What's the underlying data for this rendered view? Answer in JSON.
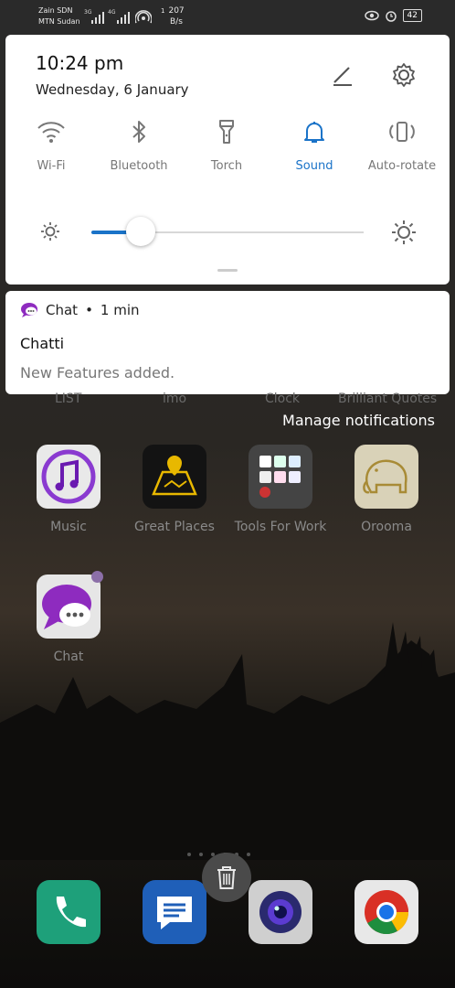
{
  "status_bar": {
    "operator_1": "Zain SDN",
    "operator_2": "MTN Sudan",
    "net_1": "3G",
    "net_2": "4G",
    "speed_value": "207",
    "speed_unit": "B/s",
    "speed_prefix": "1",
    "battery": "42"
  },
  "quick_settings": {
    "time": "10:24 pm",
    "date": "Wednesday, 6 January",
    "tiles": [
      {
        "label": "Wi-Fi",
        "icon": "wifi-icon",
        "active": false
      },
      {
        "label": "Bluetooth",
        "icon": "bluetooth-icon",
        "active": false
      },
      {
        "label": "Torch",
        "icon": "torch-icon",
        "active": false
      },
      {
        "label": "Sound",
        "icon": "bell-icon",
        "active": true
      },
      {
        "label": "Auto-rotate",
        "icon": "auto-rotate-icon",
        "active": false
      }
    ],
    "brightness_level": 0.18,
    "accent_color": "#1a73c8"
  },
  "notification": {
    "app_name": "Chat",
    "separator": "•",
    "age": "1 min",
    "title": "Chatti",
    "body": "New Features added."
  },
  "manage_notifications": "Manage notifications",
  "home": {
    "hidden_labels": [
      "LIST",
      "imo",
      "Clock",
      "Brilliant Quotes"
    ],
    "apps_row1": [
      {
        "label": "Music",
        "icon": "music-icon"
      },
      {
        "label": "Great Places",
        "icon": "map-icon"
      },
      {
        "label": "Tools For Work",
        "icon": "folder-icon"
      },
      {
        "label": "Orooma",
        "icon": "elephant-icon"
      }
    ],
    "apps_row2": [
      {
        "label": "Chat",
        "icon": "chat-bubble-icon"
      }
    ],
    "dock": [
      "phone-icon",
      "messages-icon",
      "camera-icon",
      "chrome-icon"
    ]
  }
}
